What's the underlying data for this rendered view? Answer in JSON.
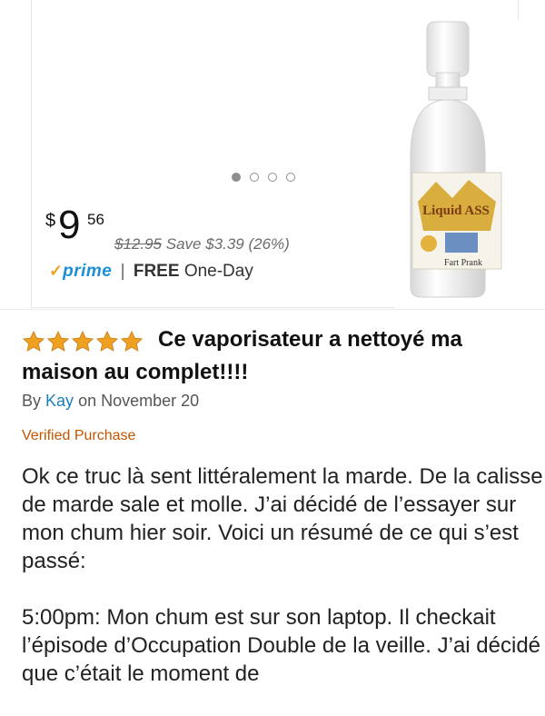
{
  "carousel": {
    "dots": 4,
    "active_index": 0
  },
  "price": {
    "currency": "$",
    "whole": "9",
    "cents": "56",
    "old": "$12.95",
    "savings": "Save $3.39 (26%)"
  },
  "prime": {
    "check": "✓",
    "label": "prime",
    "separator": "|",
    "free": "FREE",
    "shipping": "One-Day"
  },
  "product_image": {
    "label": "Fart Prank",
    "brand_text": "Liquid ASS"
  },
  "review": {
    "rating": 5,
    "title": "Ce vaporisateur a nettoyé ma maison au complet!!!!",
    "by": "By",
    "author": "Kay",
    "on": "on",
    "date": "November 20",
    "verified": "Verified Purchase",
    "paragraph1": "Ok ce truc là sent littéralement la marde. De la calisse de marde sale et molle. J’ai décidé de l’essayer sur mon chum hier soir. Voici un résumé de ce qui s’est passé:",
    "paragraph2": "5:00pm: Mon chum est sur son laptop. Il checkait l’épisode d’Occupation Double de la veille. J’ai décidé que c’était le moment de"
  },
  "colors": {
    "star": "#f0a020",
    "prime_blue": "#1a8fd6",
    "link": "#1a7fc1",
    "verified": "#c45500"
  }
}
